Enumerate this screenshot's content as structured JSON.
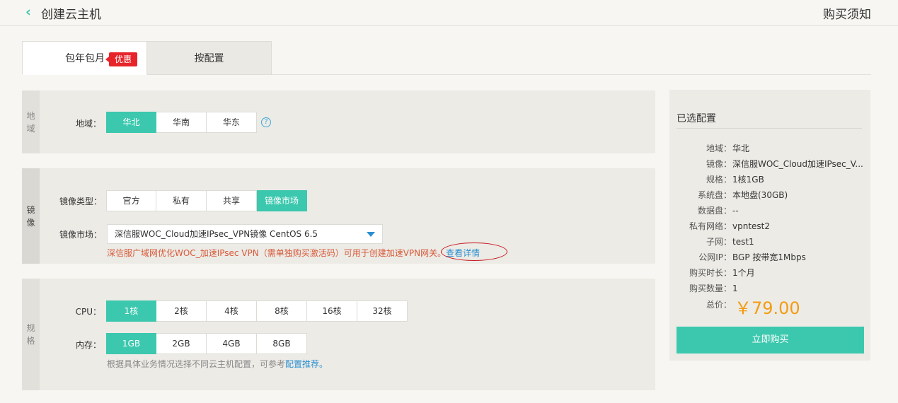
{
  "header": {
    "back_icon": "chevron-left-icon",
    "title": "创建云主机",
    "notice": "购买须知"
  },
  "tabs": [
    {
      "label": "包年包月",
      "badge": "优惠"
    },
    {
      "label": "按配置"
    }
  ],
  "region": {
    "side": [
      "地",
      "域"
    ],
    "label": "地域：",
    "options": [
      "华北",
      "华南",
      "华东"
    ],
    "selected": "华北",
    "help_icon": "?"
  },
  "image": {
    "side": [
      "镜",
      "像"
    ],
    "type_label": "镜像类型：",
    "types": [
      "官方",
      "私有",
      "共享",
      "镜像市场"
    ],
    "selected_type": "镜像市场",
    "market_label": "镜像市场：",
    "market_value": "深信服WOC_Cloud加速IPsec_VPN镜像 CentOS 6.5",
    "description": "深信服广域网优化WOC_加速IPsec VPN（需单独购买激活码）可用于创建加速VPN网关。",
    "detail_link": "查看详情"
  },
  "spec": {
    "side": [
      "规",
      "格"
    ],
    "cpu_label": "CPU：",
    "cpu_options": [
      "1核",
      "2核",
      "4核",
      "8核",
      "16核",
      "32核"
    ],
    "cpu_selected": "1核",
    "mem_label": "内存：",
    "mem_options": [
      "1GB",
      "2GB",
      "4GB",
      "8GB"
    ],
    "mem_selected": "1GB",
    "hint_text": "根据具体业务情况选择不同云主机配置，可参考",
    "hint_link": "配置推荐。"
  },
  "summary": {
    "title": "已选配置",
    "rows": [
      {
        "k": "地域：",
        "v": "华北"
      },
      {
        "k": "镜像：",
        "v": "深信服WOC_Cloud加速IPsec_V..."
      },
      {
        "k": "规格：",
        "v": "1核1GB"
      },
      {
        "k": "系统盘：",
        "v": "本地盘(30GB)"
      },
      {
        "k": "数据盘：",
        "v": "--"
      },
      {
        "k": "私有网络：",
        "v": "vpntest2"
      },
      {
        "k": "子网：",
        "v": "test1"
      },
      {
        "k": "公网IP：",
        "v": "BGP 按带宽1Mbps"
      },
      {
        "k": "购买时长：",
        "v": "1个月"
      },
      {
        "k": "购买数量：",
        "v": "1"
      }
    ],
    "total_label": "总价：",
    "total_value": "￥79.00",
    "buy_button": "立即购买"
  },
  "colors": {
    "accent": "#3cc8ae",
    "price": "#f39c12",
    "promo": "#e8242b",
    "link": "#2a8fd0"
  }
}
